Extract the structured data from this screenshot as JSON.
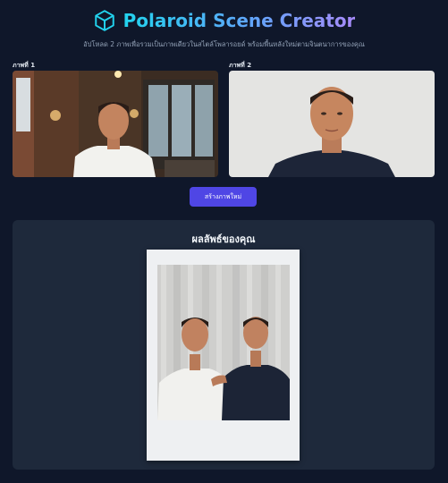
{
  "header": {
    "title": "Polaroid Scene Creator",
    "subtitle": "อัปโหลด 2 ภาพเพื่อรวมเป็นภาพเดียวในสไตล์โพลารอยด์ พร้อมพื้นหลังใหม่ตามจินตนาการของคุณ",
    "logo_icon": "cube-icon",
    "accent_colors": [
      "#22d3ee",
      "#60a5fa",
      "#a78bfa"
    ]
  },
  "uploads": [
    {
      "label": "ภาพที่ 1"
    },
    {
      "label": "ภาพที่ 2"
    }
  ],
  "actions": {
    "create_label": "สร้างภาพใหม่",
    "button_color": "#4f46e5"
  },
  "result": {
    "title": "ผลลัพธ์ของคุณ"
  }
}
